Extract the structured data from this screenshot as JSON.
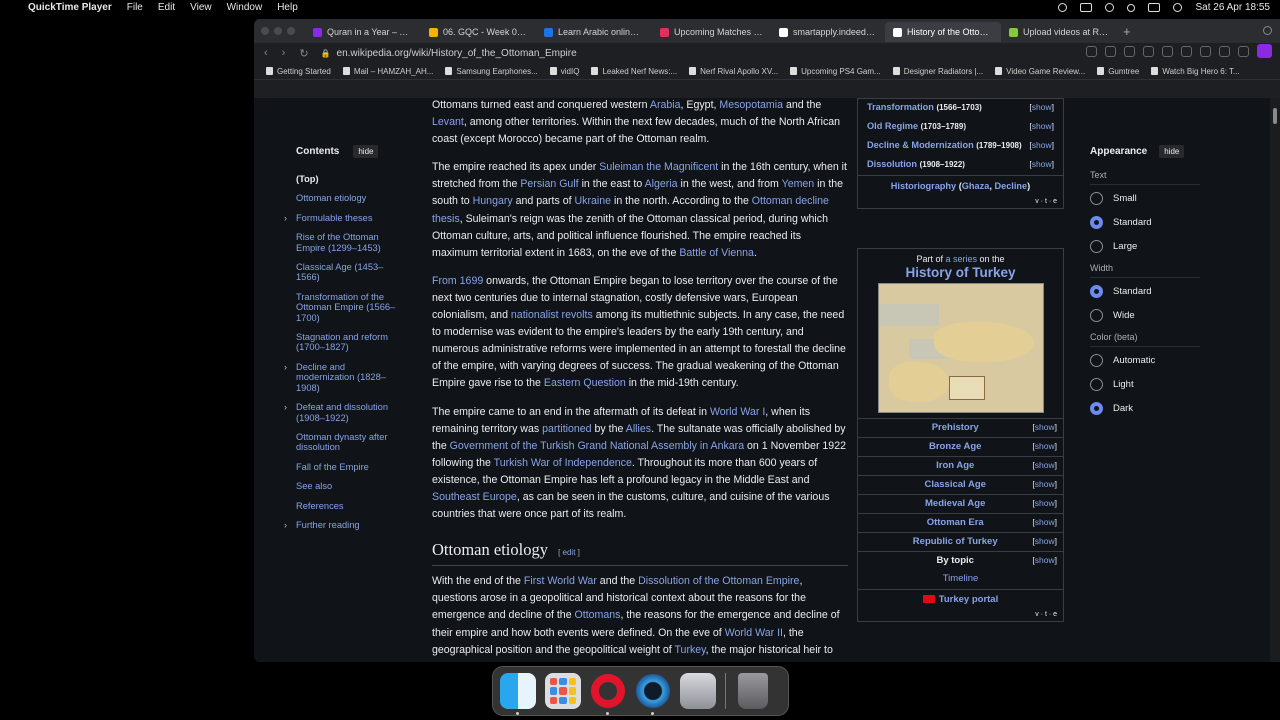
{
  "menubar": {
    "app_name": "QuickTime Player",
    "menus": [
      "File",
      "Edit",
      "View",
      "Window",
      "Help"
    ],
    "clock": "Sat 26 Apr  18:55"
  },
  "browser": {
    "tabs": [
      {
        "title": "Quran in a Year – A Simp",
        "color": "#8a2be2",
        "active": false
      },
      {
        "title": "06. GQC - Week 06.pdf",
        "color": "#f4b400",
        "active": false
      },
      {
        "title": "Learn Arabic online | I",
        "color": "#1a73e8",
        "active": false
      },
      {
        "title": "Upcoming Matches | Tic",
        "color": "#e03060",
        "active": false
      },
      {
        "title": "smartapply.indeed.com",
        "color": "#ffffff",
        "active": false
      },
      {
        "title": "History of the Ottoman",
        "color": "#ffffff",
        "active": true
      },
      {
        "title": "Upload videos at Rumbl",
        "color": "#85c742",
        "active": false
      }
    ],
    "url": "en.wikipedia.org/wiki/History_of_the_Ottoman_Empire",
    "bookmarks": [
      "Getting Started",
      "Mail – HAMZAH_AH...",
      "Samsung Earphones...",
      "vidIQ",
      "Leaked Nerf News:...",
      "Nerf Rival Apollo XV...",
      "Upcoming PS4 Gam...",
      "Designer Radiators |...",
      "Video Game Review...",
      "Gumtree",
      "Watch Big Hero 6: T..."
    ]
  },
  "toc": {
    "title": "Contents",
    "hide": "hide",
    "items": [
      {
        "label": "(Top)",
        "expandable": false
      },
      {
        "label": "Ottoman etiology",
        "expandable": false
      },
      {
        "label": "Formulable theses",
        "expandable": true
      },
      {
        "label": "Rise of the Ottoman Empire (1299–1453)",
        "expandable": false
      },
      {
        "label": "Classical Age (1453–1566)",
        "expandable": false
      },
      {
        "label": "Transformation of the Ottoman Empire (1566–1700)",
        "expandable": false
      },
      {
        "label": "Stagnation and reform (1700–1827)",
        "expandable": false
      },
      {
        "label": "Decline and modernization (1828–1908)",
        "expandable": true
      },
      {
        "label": "Defeat and dissolution (1908–1922)",
        "expandable": true
      },
      {
        "label": "Ottoman dynasty after dissolution",
        "expandable": false
      },
      {
        "label": "Fall of the Empire",
        "expandable": false
      },
      {
        "label": "See also",
        "expandable": false
      },
      {
        "label": "References",
        "expandable": false
      },
      {
        "label": "Further reading",
        "expandable": true
      }
    ]
  },
  "article": {
    "p1": [
      {
        "t": "Ottomans turned east and conquered western "
      },
      {
        "a": "Arabia"
      },
      {
        "t": ", Egypt, "
      },
      {
        "a": "Mesopotamia"
      },
      {
        "t": " and the "
      },
      {
        "a": "Levant"
      },
      {
        "t": ", among other territories. Within the next few decades, much of the North African coast (except Morocco) became part of the Ottoman realm."
      }
    ],
    "p2": [
      {
        "t": "The empire reached its apex under "
      },
      {
        "a": "Suleiman the Magnificent"
      },
      {
        "t": " in the 16th century, when it stretched from the "
      },
      {
        "a": "Persian Gulf"
      },
      {
        "t": " in the east to "
      },
      {
        "a": "Algeria"
      },
      {
        "t": " in the west, and from "
      },
      {
        "a": "Yemen"
      },
      {
        "t": " in the south to "
      },
      {
        "a": "Hungary"
      },
      {
        "t": " and parts of "
      },
      {
        "a": "Ukraine"
      },
      {
        "t": " in the north. According to the "
      },
      {
        "a": "Ottoman decline thesis"
      },
      {
        "t": ", Suleiman's reign was the zenith of the Ottoman classical period, during which Ottoman culture, arts, and political influence flourished. The empire reached its maximum territorial extent in 1683, on the eve of the "
      },
      {
        "a": "Battle of Vienna"
      },
      {
        "t": "."
      }
    ],
    "p3": [
      {
        "a": "From 1699"
      },
      {
        "t": " onwards, the Ottoman Empire began to lose territory over the course of the next two centuries due to internal stagnation, costly defensive wars, European colonialism, and "
      },
      {
        "a": "nationalist revolts"
      },
      {
        "t": " among its multiethnic subjects. In any case, the need to modernise was evident to the empire's leaders by the early 19th century, and numerous administrative reforms were implemented in an attempt to forestall the decline of the empire, with varying degrees of success. The gradual weakening of the Ottoman Empire gave rise to the "
      },
      {
        "a": "Eastern Question"
      },
      {
        "t": " in the mid-19th century."
      }
    ],
    "p4": [
      {
        "t": "The empire came to an end in the aftermath of its defeat in "
      },
      {
        "a": "World War I"
      },
      {
        "t": ", when its remaining territory was "
      },
      {
        "a": "partitioned"
      },
      {
        "t": " by the "
      },
      {
        "a": "Allies"
      },
      {
        "t": ". The sultanate was officially abolished by the "
      },
      {
        "a": "Government of the Turkish Grand National Assembly in Ankara"
      },
      {
        "t": " on 1 November 1922 following the "
      },
      {
        "a": "Turkish War of Independence"
      },
      {
        "t": ". Throughout its more than 600 years of existence, the Ottoman Empire has left a profound legacy in the Middle East and "
      },
      {
        "a": "Southeast Europe"
      },
      {
        "t": ", as can be seen in the customs, culture, and cuisine of the various countries that were once part of its realm."
      }
    ],
    "heading": "Ottoman etiology",
    "edit": "edit",
    "p5": [
      {
        "t": "With the end of the "
      },
      {
        "a": "First World War"
      },
      {
        "t": " and the "
      },
      {
        "a": "Dissolution of the Ottoman Empire"
      },
      {
        "t": ", questions arose in a geopolitical and historical context about the reasons for the emergence and decline of the "
      },
      {
        "a": "Ottomans"
      },
      {
        "t": ", the reasons for the emergence and decline of their empire and how both events were defined. On the eve of "
      },
      {
        "a": "World War II"
      },
      {
        "t": ", the geographical position and the geopolitical weight of "
      },
      {
        "a": "Turkey"
      },
      {
        "t": ", the major historical heir to"
      }
    ]
  },
  "navbox1": {
    "rows": [
      {
        "label": "Transformation",
        "years": "(1566–1703)"
      },
      {
        "label": "Old Regime",
        "years": "(1703–1789)"
      },
      {
        "label": "Decline & Modernization",
        "years": "(1789–1908)"
      },
      {
        "label": "Dissolution",
        "years": "(1908–1922)"
      }
    ],
    "show": "show",
    "historiography": "Historiography",
    "historiography_links": [
      "Ghaza",
      "Decline"
    ],
    "vte": "v · t · e"
  },
  "navbox2": {
    "part_of": "Part of",
    "a_series": "a series",
    "on_the": "on the",
    "title": "History of Turkey",
    "rows": [
      {
        "label": "Prehistory",
        "link": true
      },
      {
        "label": "Bronze Age",
        "link": true
      },
      {
        "label": "Iron Age",
        "link": true
      },
      {
        "label": "Classical Age",
        "link": true
      },
      {
        "label": "Medieval Age",
        "link": true
      },
      {
        "label": "Ottoman Era",
        "link": true
      },
      {
        "label": "Republic of Turkey",
        "link": true
      },
      {
        "label": "By topic",
        "link": false
      }
    ],
    "timeline": "Timeline",
    "portal": "Turkey portal",
    "show": "show",
    "vte": "v · t · e"
  },
  "appearance": {
    "title": "Appearance",
    "hide": "hide",
    "groups": [
      {
        "label": "Text",
        "options": [
          {
            "label": "Small",
            "on": false
          },
          {
            "label": "Standard",
            "on": true
          },
          {
            "label": "Large",
            "on": false
          }
        ]
      },
      {
        "label": "Width",
        "options": [
          {
            "label": "Standard",
            "on": true
          },
          {
            "label": "Wide",
            "on": false
          }
        ]
      },
      {
        "label": "Color (beta)",
        "options": [
          {
            "label": "Automatic",
            "on": false
          },
          {
            "label": "Light",
            "on": false
          },
          {
            "label": "Dark",
            "on": true
          }
        ]
      }
    ]
  },
  "dock": {
    "apps": [
      "finder-icon",
      "launchpad-icon",
      "opera-icon",
      "quicktime-icon",
      "migration-assistant-icon",
      "trash-icon"
    ]
  }
}
